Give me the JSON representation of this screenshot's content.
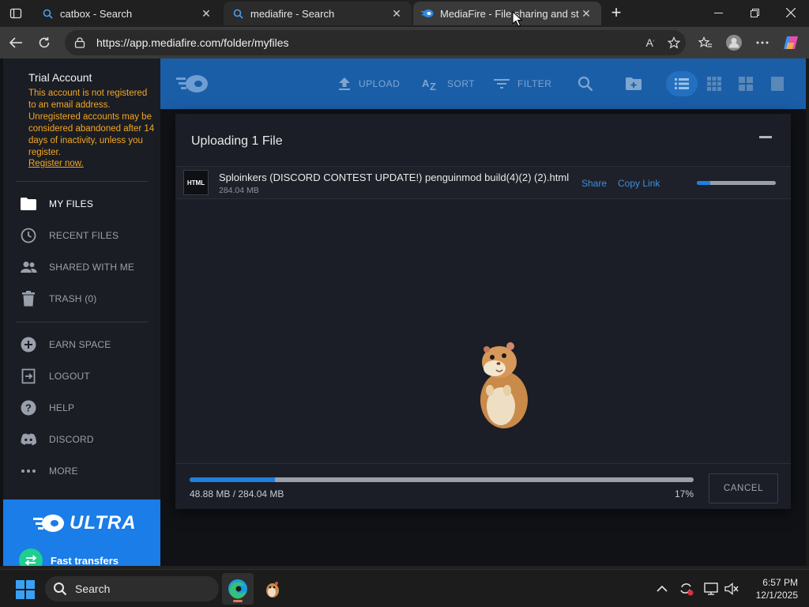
{
  "browser": {
    "tabs": [
      {
        "title": "catbox - Search",
        "favicon": "search-icon"
      },
      {
        "title": "mediafire - Search",
        "favicon": "search-icon"
      },
      {
        "title": "MediaFire - File sharing and stora",
        "favicon": "mediafire-icon"
      }
    ],
    "url": "https://app.mediafire.com/folder/myfiles"
  },
  "sidebar": {
    "account_title": "Trial Account",
    "account_warning": "This account is not registered to an email address. Unregistered accounts may be considered abandoned after 14 days of inactivity, unless you register.",
    "register_link": "Register now.",
    "nav": [
      {
        "label": "MY FILES",
        "icon": "folder-icon",
        "active": true
      },
      {
        "label": "RECENT FILES",
        "icon": "clock-icon",
        "active": false
      },
      {
        "label": "SHARED WITH ME",
        "icon": "people-icon",
        "active": false
      },
      {
        "label": "TRASH (0)",
        "icon": "trash-icon",
        "active": false
      },
      {
        "label": "EARN SPACE",
        "icon": "plus-circle-icon",
        "active": false
      },
      {
        "label": "LOGOUT",
        "icon": "logout-icon",
        "active": false
      },
      {
        "label": "HELP",
        "icon": "help-icon",
        "active": false
      },
      {
        "label": "DISCORD",
        "icon": "discord-icon",
        "active": false
      },
      {
        "label": "MORE",
        "icon": "more-icon",
        "active": false
      }
    ],
    "promo": {
      "brand": "ULTRA",
      "feature": "Fast transfers"
    }
  },
  "header": {
    "upload_label": "UPLOAD",
    "sort_label": "SORT",
    "filter_label": "FILTER"
  },
  "upload_modal": {
    "title": "Uploading 1 File",
    "file": {
      "type_badge": "HTML",
      "name": "Sploinkers (DISCORD CONTEST UPDATE!) penguinmod build(4)(2) (2).html",
      "size": "284.04 MB",
      "share_label": "Share",
      "copy_link_label": "Copy Link",
      "progress": 0.17
    },
    "total": {
      "transferred": "48.88 MB / 284.04 MB",
      "percent_text": "17%",
      "progress": 0.17
    },
    "cancel_label": "CANCEL"
  },
  "taskbar": {
    "search_label": "Search",
    "time": "6:57 PM",
    "date": "12/1/2025"
  },
  "colors": {
    "accent": "#1f7fe0",
    "header": "#1a5ea8",
    "warning": "#f5a623",
    "promo": "#1a7de8"
  }
}
